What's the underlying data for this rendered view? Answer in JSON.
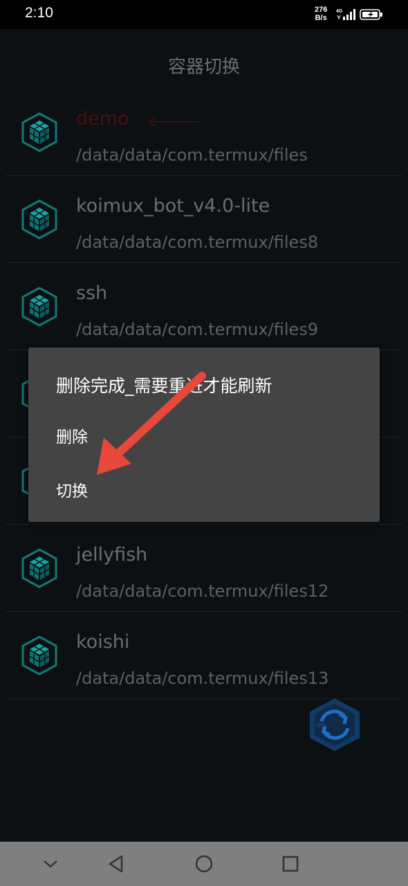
{
  "status_bar": {
    "time": "2:10",
    "net_speed_value": "276",
    "net_speed_unit": "B/s",
    "network_type": "4G"
  },
  "app": {
    "title": "容器切换",
    "containers": [
      {
        "name": "demo",
        "path": "/data/data/com.termux/files",
        "highlight": true
      },
      {
        "name": "koimux_bot_v4.0-lite",
        "path": "/data/data/com.termux/files8"
      },
      {
        "name": "ssh",
        "path": "/data/data/com.termux/files9"
      },
      {
        "name": "",
        "path": ""
      },
      {
        "name": "",
        "path": ""
      },
      {
        "name": "jellyfish",
        "path": "/data/data/com.termux/files12"
      },
      {
        "name": "koishi",
        "path": "/data/data/com.termux/files13"
      }
    ]
  },
  "dialog": {
    "title": "删除完成_需要重进才能刷新",
    "delete_label": "删除",
    "switch_label": "切换"
  },
  "colors": {
    "accent_teal": "#1aa3a3",
    "annotation_red": "#e8473b",
    "fab_blue": "#1f6fc4"
  },
  "icons": {
    "container": "cube-icon",
    "fab": "switch-icon",
    "nav": [
      "chevron-down-icon",
      "back-icon",
      "home-icon",
      "recents-icon"
    ]
  }
}
